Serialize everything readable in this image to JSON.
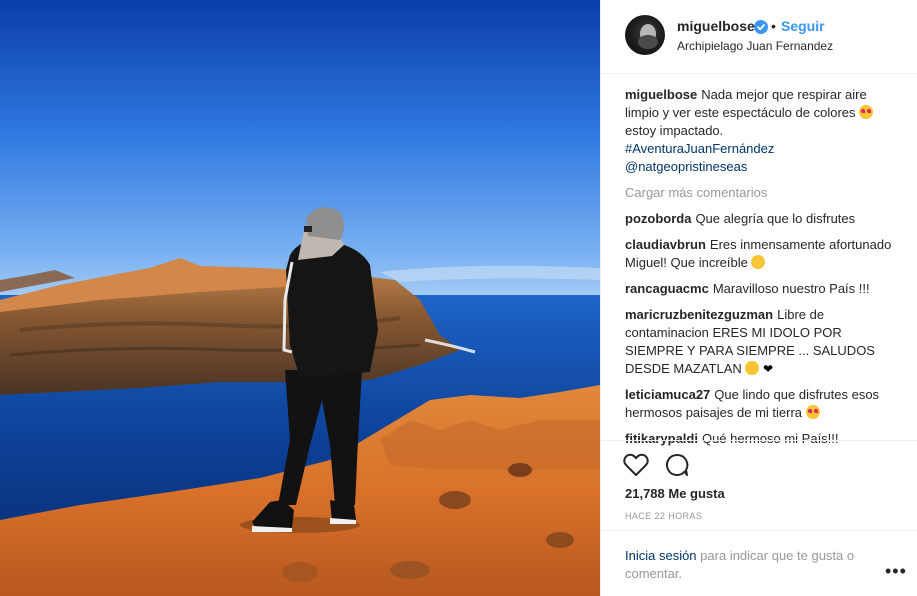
{
  "post": {
    "username": "miguelbose",
    "follow_label": "Seguir",
    "location": "Archipielago Juan Fernandez",
    "caption": {
      "user": "miguelbose",
      "text": "Nada mejor que respirar aire limpio y ver este espectáculo de colores",
      "text_after": "estoy impactado.",
      "hashtag": "#AventuraJuanFernández",
      "mention": "@natgeopristineseas"
    },
    "load_more_label": "Cargar más comentarios",
    "comments": [
      {
        "user": "pozoborda",
        "text": "Que alegría que lo disfrutes"
      },
      {
        "user": "claudiavbrun",
        "text": "Eres inmensamente afortunado Miguel! Que increíble"
      },
      {
        "user": "rancaguacmc",
        "text": "Maravilloso nuestro País !!!"
      },
      {
        "user": "maricruzbenitezguzman",
        "text": "Libre de contaminacion ERES MI IDOLO POR SIEMPRE Y PARA SIEMPRE ... SALUDOS DESDE MAZATLAN"
      },
      {
        "user": "leticiamuca27",
        "text": "Que lindo que disfrutes esos hermosos paisajes de mi tierra"
      },
      {
        "user": "fitikarypaldi",
        "text": "Qué hermoso mi País!!!"
      }
    ],
    "likes": "21,788 Me gusta",
    "timestamp": "HACE 22 HORAS",
    "login_link": "Inicia sesión",
    "login_text": "para indicar que te gusta o comentar.",
    "more_label": "•••",
    "dot": "•"
  },
  "icons": {
    "verified": "verified-badge-icon",
    "like": "heart-outline-icon",
    "comment": "comment-bubble-icon",
    "more": "more-options-icon"
  },
  "colors": {
    "link_blue": "#3897f0",
    "hashtag_blue": "#003569",
    "muted_gray": "#999999",
    "text": "#262626",
    "border": "#efefef"
  }
}
